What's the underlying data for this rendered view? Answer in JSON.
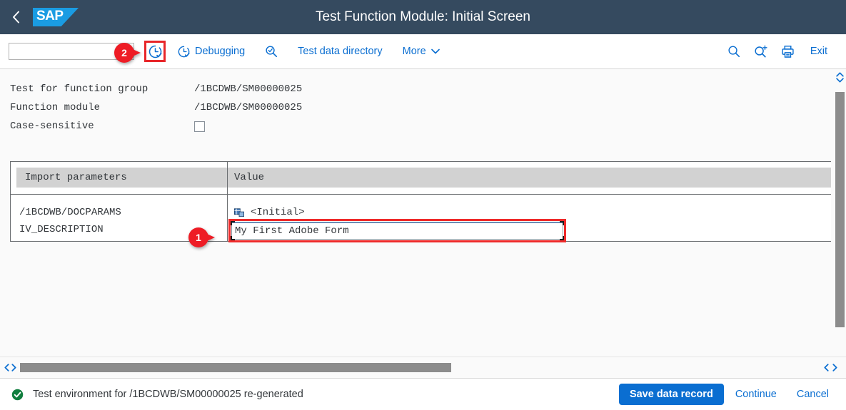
{
  "header": {
    "title": "Test Function Module: Initial Screen",
    "logo_text": "SAP",
    "back_icon": "back-chevron-icon"
  },
  "toolbar": {
    "command_value": "",
    "command_placeholder": "",
    "execute_icon": "clock-check-execute-icon",
    "items": [
      {
        "label": "Debugging",
        "icon": "clock-check-icon"
      },
      {
        "label": "",
        "icon": "magnifier-execute-icon"
      },
      {
        "label": "Test data directory",
        "icon": ""
      },
      {
        "label": "More",
        "icon": "chevron-down-icon"
      }
    ],
    "right_icons": [
      {
        "name": "search-icon"
      },
      {
        "name": "search-plus-icon"
      },
      {
        "name": "print-icon"
      }
    ],
    "exit_label": "Exit"
  },
  "form": {
    "rows": [
      {
        "label": "Test for function group",
        "value": "/1BCDWB/SM00000025",
        "type": "text"
      },
      {
        "label": "Function module",
        "value": "/1BCDWB/SM00000025",
        "type": "text"
      },
      {
        "label": "Case-sensitive",
        "value": "",
        "type": "checkbox",
        "checked": false
      }
    ]
  },
  "parameters_table": {
    "columns": [
      "Import parameters",
      "Value"
    ],
    "rows": [
      {
        "name": "/1BCDWB/DOCPARAMS",
        "value": "<Initial>",
        "icon": "structure-icon",
        "kind": "structure"
      },
      {
        "name": "IV_DESCRIPTION",
        "value": "My First Adobe Form",
        "icon": "",
        "kind": "input"
      }
    ]
  },
  "annotations": [
    {
      "number": "1",
      "target": "value-input-iv-description"
    },
    {
      "number": "2",
      "target": "execute-button"
    }
  ],
  "footer": {
    "status_message": "Test environment for /1BCDWB/SM00000025 re-generated",
    "status_icon": "success-check-icon",
    "save_label": "Save data record",
    "continue_label": "Continue",
    "cancel_label": "Cancel"
  },
  "colors": {
    "shell_header_bg": "#354a5f",
    "accent_blue": "#0a6ed1",
    "logo_blue": "#1a9ce3",
    "highlight_red": "#ee2a2a",
    "success_green": "#107e3e",
    "table_header_gray": "#d2d2d2"
  }
}
